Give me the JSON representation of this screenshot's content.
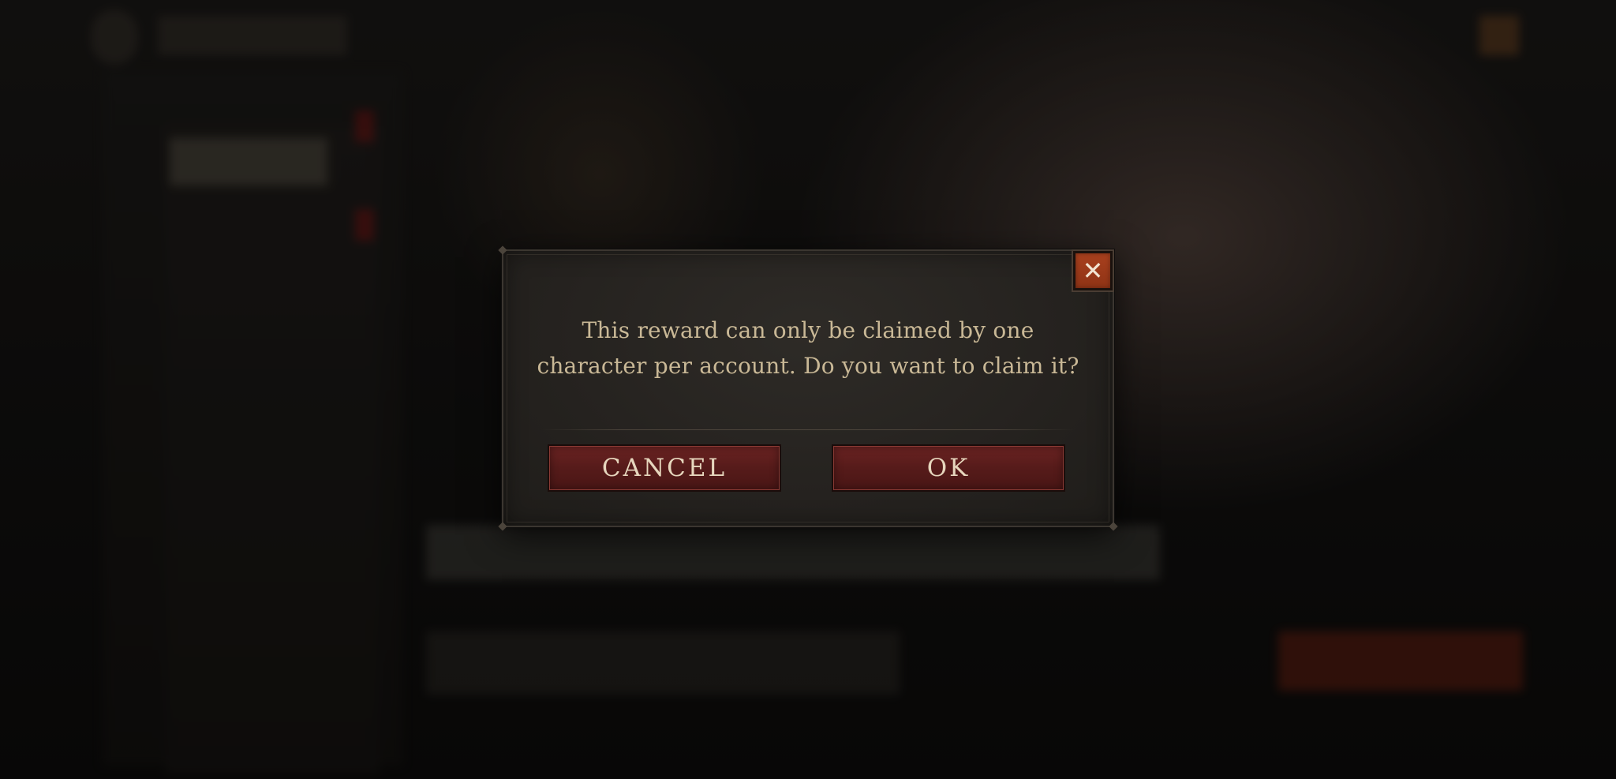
{
  "dialog": {
    "message_line1": "This reward can only be claimed by one",
    "message_line2": "character per account. Do you want to claim it?",
    "cancel_label": "CANCEL",
    "ok_label": "OK",
    "close_icon": "close-icon",
    "close_glyph": "✕"
  },
  "colors": {
    "dialog_background": "#25221f",
    "message_text": "#c9b896",
    "button_fill": "#561b1a",
    "button_text": "#e6d6bd",
    "close_button_fill": "#a8401e"
  }
}
